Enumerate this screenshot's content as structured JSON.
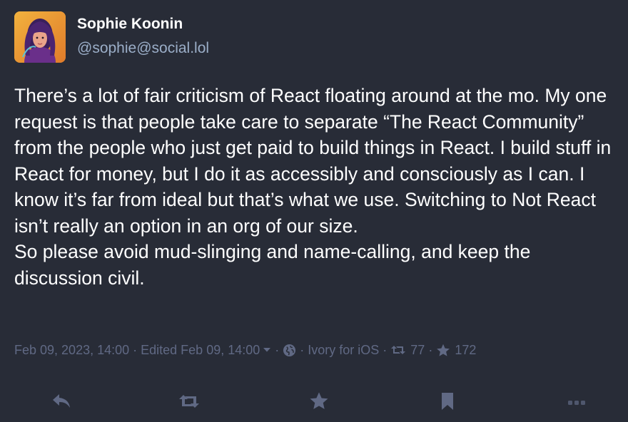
{
  "author": {
    "display_name": "Sophie Koonin",
    "handle": "@sophie@social.lol",
    "avatar_icon": "avatar"
  },
  "content": {
    "paragraphs": [
      "There’s a lot of fair criticism of React floating around at the mo. My one request is that people take care to separate “The React Community” from the people who just get paid to build things in React. I build stuff in React for money, but I do it as accessibly and consciously as I can. I know it’s far from ideal but that’s what we use. Switching to Not React isn’t really an option in an org of our size.",
      "So please avoid mud-slinging and name-calling, and keep the discussion civil."
    ]
  },
  "meta": {
    "date": "Feb 09, 2023, 14:00",
    "edited": "Edited Feb 09, 14:00",
    "visibility_icon": "globe-icon",
    "application": "Ivory for iOS",
    "boost_count": "77",
    "favourite_count": "172",
    "separator": "·"
  },
  "actions": [
    {
      "name": "reply",
      "icon": "reply-icon"
    },
    {
      "name": "boost",
      "icon": "boost-icon"
    },
    {
      "name": "favourite",
      "icon": "star-icon"
    },
    {
      "name": "bookmark",
      "icon": "bookmark-icon"
    },
    {
      "name": "more",
      "icon": "ellipsis-icon"
    }
  ],
  "colors": {
    "background": "#282c37",
    "text": "#ffffff",
    "secondary_text": "#9baec8",
    "muted": "#606984"
  }
}
